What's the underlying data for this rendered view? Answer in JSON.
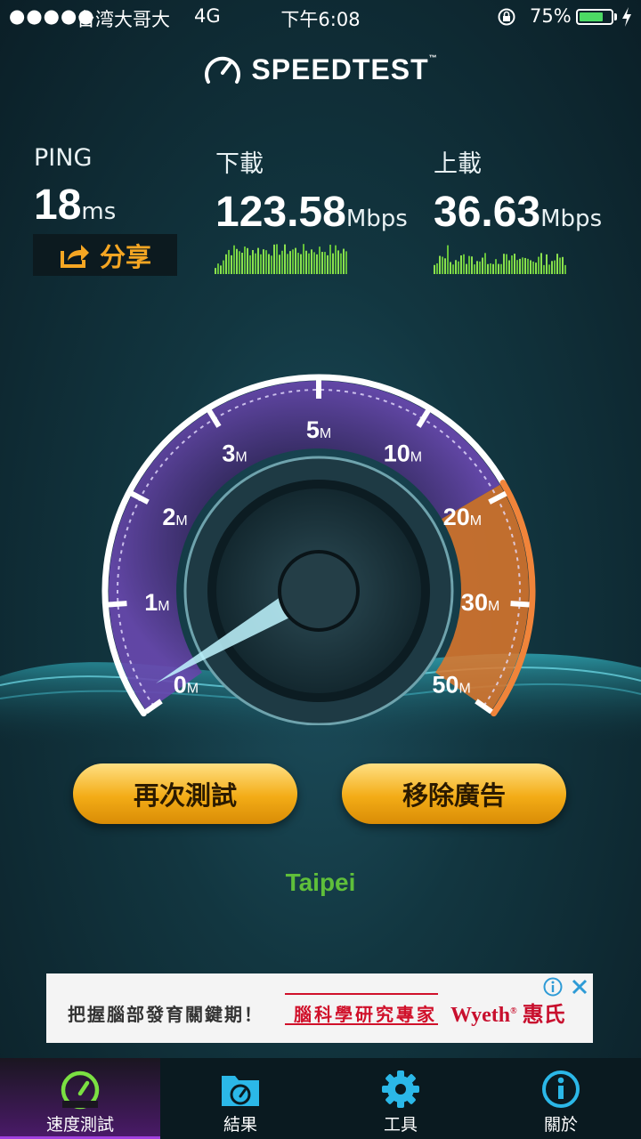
{
  "status_bar": {
    "signal": "●●●●●",
    "carrier": "台湾大哥大",
    "network": "4G",
    "time": "下午6:08",
    "battery_percent": "75%",
    "battery_level": 0.75
  },
  "header": {
    "logo_text": "SPEEDTEST",
    "trademark": "™"
  },
  "results": {
    "ping": {
      "label": "PING",
      "value": "18",
      "unit": "ms"
    },
    "download": {
      "label": "下載",
      "value": "123.58",
      "unit": "Mbps"
    },
    "upload": {
      "label": "上載",
      "value": "36.63",
      "unit": "Mbps"
    }
  },
  "share_button": {
    "label": "分享"
  },
  "gauge": {
    "ticks": [
      {
        "value": "0",
        "unit": "M"
      },
      {
        "value": "1",
        "unit": "M"
      },
      {
        "value": "2",
        "unit": "M"
      },
      {
        "value": "3",
        "unit": "M"
      },
      {
        "value": "5",
        "unit": "M"
      },
      {
        "value": "10",
        "unit": "M"
      },
      {
        "value": "20",
        "unit": "M"
      },
      {
        "value": "30",
        "unit": "M"
      },
      {
        "value": "50",
        "unit": "M"
      }
    ],
    "colors": {
      "ring": "#ffffff",
      "fill": "#5b3b9a",
      "high_zone": "#e0782c"
    }
  },
  "buttons": {
    "retest": "再次測試",
    "remove_ads": "移除廣告"
  },
  "server": {
    "location": "Taipei"
  },
  "ad": {
    "text": "把握腦部發育關鍵期！",
    "highlight": "腦科學研究專家",
    "brand": "Wyeth",
    "brand_cn": "惠氏"
  },
  "tabs": [
    {
      "label": "速度測試",
      "icon": "speedometer-icon",
      "active": true
    },
    {
      "label": "結果",
      "icon": "results-folder-icon",
      "active": false
    },
    {
      "label": "工具",
      "icon": "gear-icon",
      "active": false
    },
    {
      "label": "關於",
      "icon": "info-icon",
      "active": false
    }
  ],
  "colors": {
    "accent": "#f5a623",
    "location": "#5fbf3a",
    "active_tab": "#a040e0"
  }
}
